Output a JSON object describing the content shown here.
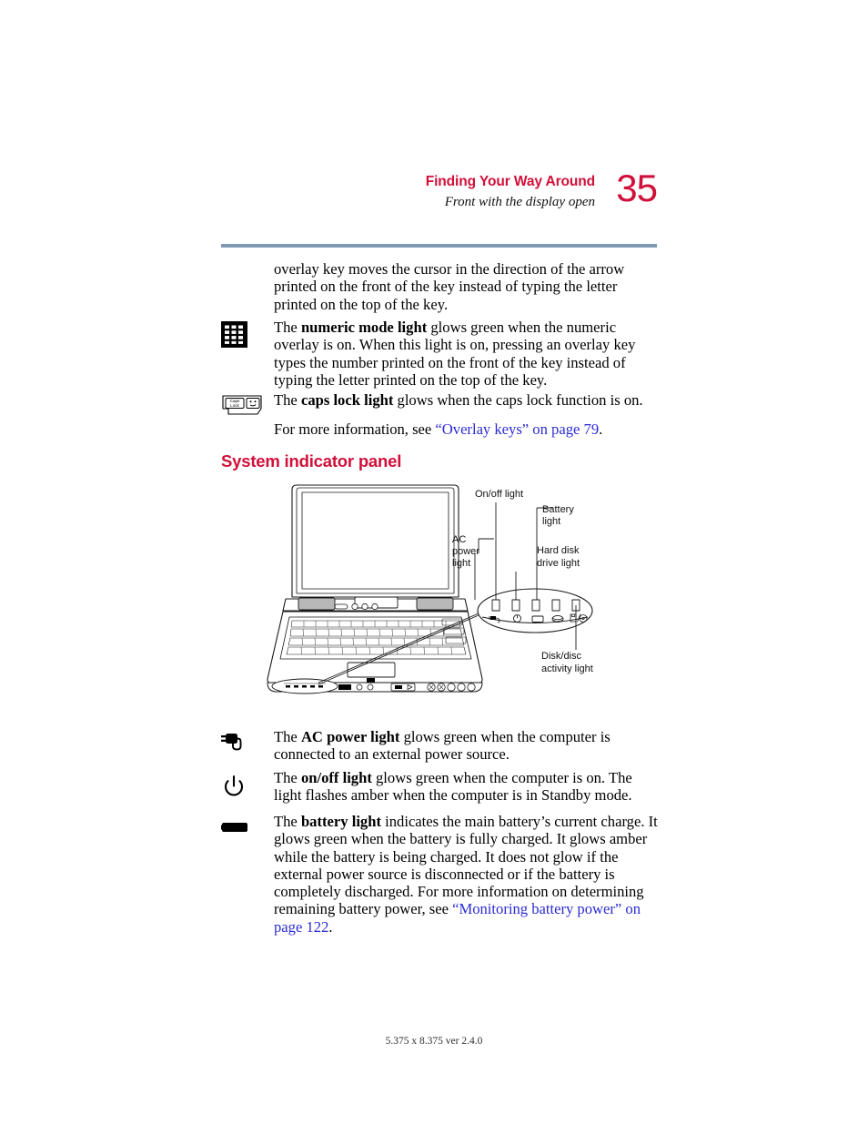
{
  "header": {
    "chapter_title": "Finding Your Way Around",
    "section_subtitle": "Front with the display open",
    "page_number": "35",
    "rule_color": "#8099b3",
    "accent_color": "#d0103a"
  },
  "body": {
    "intro_paragraph": "overlay key moves the cursor in the direction of the arrow printed on the front of the key instead of typing the letter printed on the top of the key.",
    "numeric_mode": {
      "icon": "numeric-mode-light-icon",
      "lead": "The ",
      "term": "numeric mode light",
      "rest": " glows green when the numeric overlay is on. When this light is on, pressing an overlay key types the number printed on the front of the key instead of typing the letter printed on the top of the key."
    },
    "caps_lock": {
      "icon": "caps-lock-key-icon",
      "key_label_line1": "Caps",
      "key_label_line2": "Lock",
      "lead": "The ",
      "term": "caps lock light",
      "rest": " glows when the caps lock function is on."
    },
    "see_also": {
      "lead": "For more information, see ",
      "link": "“Overlay keys” on page 79",
      "trail": "."
    }
  },
  "section": {
    "heading": "System indicator panel"
  },
  "figure": {
    "name": "laptop-system-indicator-panel-diagram",
    "callouts": {
      "on_off": "On/off light",
      "battery_line1": "Battery",
      "battery_line2": "light",
      "ac_power_line1": "AC",
      "ac_power_line2": "power",
      "ac_power_line3": "light",
      "hard_disk_line1": "Hard disk",
      "hard_disk_line2": "drive light",
      "disk_disc_line1": "Disk/disc",
      "disk_disc_line2": "activity light"
    },
    "indicator_icons": [
      "ac-plug-icon",
      "power-on-off-icon",
      "battery-icon",
      "hard-disk-drive-icon",
      "disk-disc-activity-icon"
    ]
  },
  "lights": {
    "ac_power": {
      "icon": "ac-power-plug-icon",
      "lead": "The ",
      "term": "AC power light",
      "rest": " glows green when the computer is connected to an external power source."
    },
    "on_off": {
      "icon": "power-button-icon",
      "lead": "The ",
      "term": "on/off light",
      "rest": " glows green when the computer is on. The light flashes amber when the computer is in Standby mode."
    },
    "battery": {
      "icon": "battery-icon",
      "lead": "The ",
      "term": "battery light",
      "rest_before_link": " indicates the main battery’s current charge. It glows green when the battery is fully charged. It glows amber while the battery is being charged. It does not glow if the external power source is disconnected or if the battery is completely discharged. For more information on determining remaining battery power, see ",
      "link": "“Monitoring battery power” on page 122",
      "trail": "."
    }
  },
  "footer": {
    "text": "5.375 x 8.375 ver 2.4.0"
  }
}
